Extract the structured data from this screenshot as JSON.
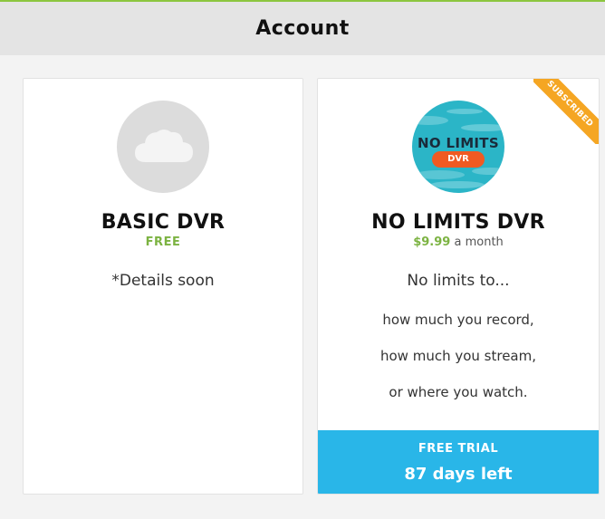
{
  "header": {
    "title": "Account"
  },
  "plans": {
    "basic": {
      "icon": "cloud-icon",
      "name": "BASIC DVR",
      "price": "FREE",
      "details": "*Details soon"
    },
    "no_limits": {
      "icon": "no-limits-dvr-logo",
      "logo_text": "NO LIMITS",
      "logo_badge": "DVR",
      "name": "NO LIMITS DVR",
      "price": "$9.99",
      "price_suffix": "a month",
      "ribbon": "SUBSCRIBED",
      "features": {
        "headline": "No limits to...",
        "lines": [
          "how much you record,",
          "how much you stream,",
          "or where you watch."
        ]
      },
      "trial": {
        "label": "FREE TRIAL",
        "days": "87 days left"
      }
    }
  },
  "colors": {
    "accent_green": "#7cb342",
    "trial_blue": "#29b6e8",
    "ribbon_orange": "#f5a623",
    "dvr_badge_orange": "#f05a22",
    "logo_teal": "#2bb5c7"
  }
}
